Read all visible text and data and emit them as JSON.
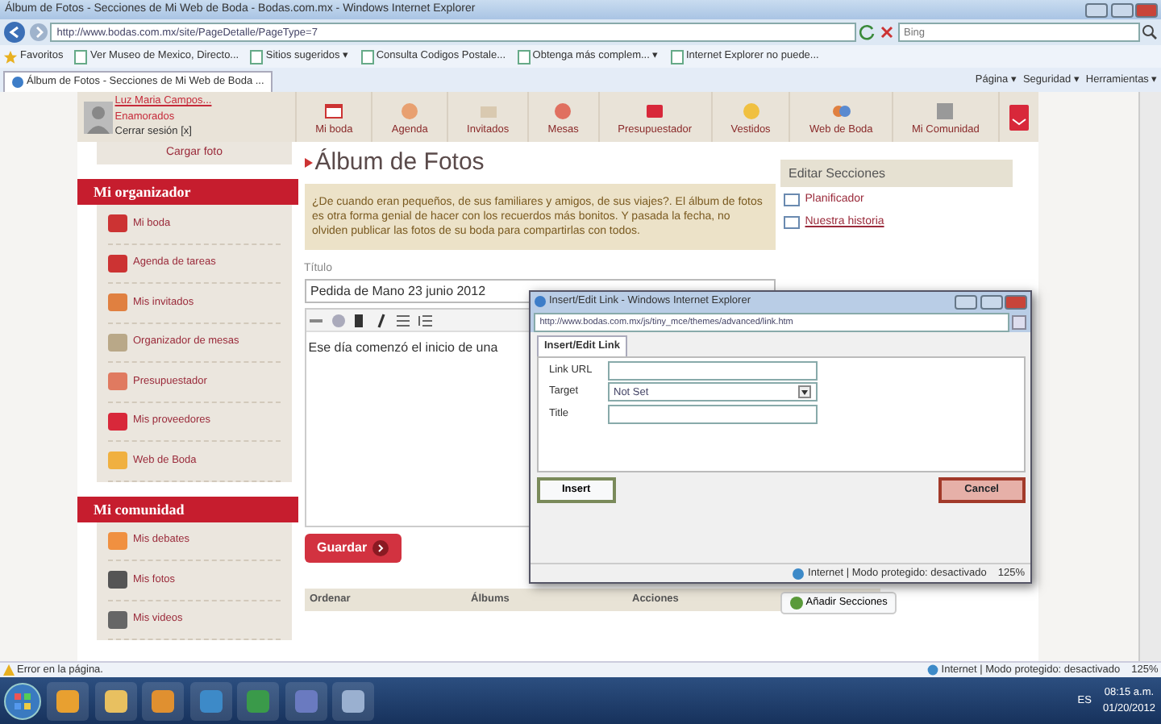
{
  "browser": {
    "title": "Álbum de Fotos - Secciones de Mi Web de Boda - Bodas.com.mx - Windows Internet Explorer",
    "url": "http://www.bodas.com.mx/site/PageDetalle/PageType=7",
    "search_placeholder": "Bing",
    "favorites": [
      {
        "label": "Favoritos",
        "kind": "star"
      },
      {
        "label": "Ver Museo de Mexico, Directo...",
        "kind": "page"
      },
      {
        "label": "Sitios sugeridos ▾",
        "kind": "page"
      },
      {
        "label": "Consulta Codigos Postale...",
        "kind": "page"
      },
      {
        "label": "Obtenga más complem... ▾",
        "kind": "page"
      },
      {
        "label": "Internet Explorer no puede...",
        "kind": "page"
      }
    ],
    "tab": "Álbum de Fotos - Secciones de Mi Web de Boda ...",
    "tools": [
      "Página ▾",
      "Seguridad ▾",
      "Herramientas ▾"
    ]
  },
  "site_nav": {
    "user_name": "Luz Maria Campos...",
    "user_subtitle": "Enamorados",
    "logout": "Cerrar sesión [x]",
    "items": [
      "Mi boda",
      "Agenda",
      "Invitados",
      "Mesas",
      "Presupuestador",
      "Vestidos",
      "Web de Boda",
      "Mi Comunidad"
    ]
  },
  "sidebar": {
    "upload_label": "Cargar foto",
    "sections": [
      {
        "title": "Mi organizador",
        "items": [
          "Mi boda",
          "Agenda de tareas",
          "Mis invitados",
          "Organizador de mesas",
          "Presupuestador",
          "Mis proveedores",
          "Web de Boda"
        ]
      },
      {
        "title": "Mi comunidad",
        "items": [
          "Mis debates",
          "Mis fotos",
          "Mis videos"
        ]
      }
    ]
  },
  "content": {
    "heading": "Álbum de Fotos",
    "intro": "¿De cuando eran pequeños, de sus familiares y amigos, de sus viajes?. El álbum de fotos es otra forma genial de hacer con los recuerdos más bonitos. Y pasada la fecha, no olviden publicar las fotos de su boda para compartirlas con todos.",
    "title_label": "Título",
    "title_value": "Pedida de Mano 23 junio 2012",
    "editor_text": "Ese día comenzó el inicio de una",
    "save_button": "Guardar",
    "table_columns": [
      "Ordenar",
      "Álbums",
      "Acciones"
    ]
  },
  "edit_sections": {
    "title": "Editar Secciones",
    "items": [
      {
        "label": "Planificador",
        "underlined": false
      },
      {
        "label": "Nuestra historia",
        "underlined": true
      }
    ],
    "add_button": "Añadir Secciones"
  },
  "dialog": {
    "title": "Insert/Edit Link - Windows Internet Explorer",
    "url": "http://www.bodas.com.mx/js/tiny_mce/themes/advanced/link.htm",
    "tab": "Insert/Edit Link",
    "fields": [
      {
        "label": "Link URL",
        "kind": "text"
      },
      {
        "label": "Target",
        "kind": "select",
        "value": "Not Set"
      },
      {
        "label": "Title",
        "kind": "text"
      }
    ],
    "insert_button": "Insert",
    "cancel_button": "Cancel",
    "status": "Internet | Modo protegido: desactivado",
    "zoom": "125%"
  },
  "status_bar": {
    "message": "Error en la página.",
    "zone": "Internet | Modo protegido: desactivado",
    "zoom": "125%"
  },
  "taskbar": {
    "language": "ES",
    "time": "08:15 a.m.",
    "date": "01/20/2012"
  }
}
